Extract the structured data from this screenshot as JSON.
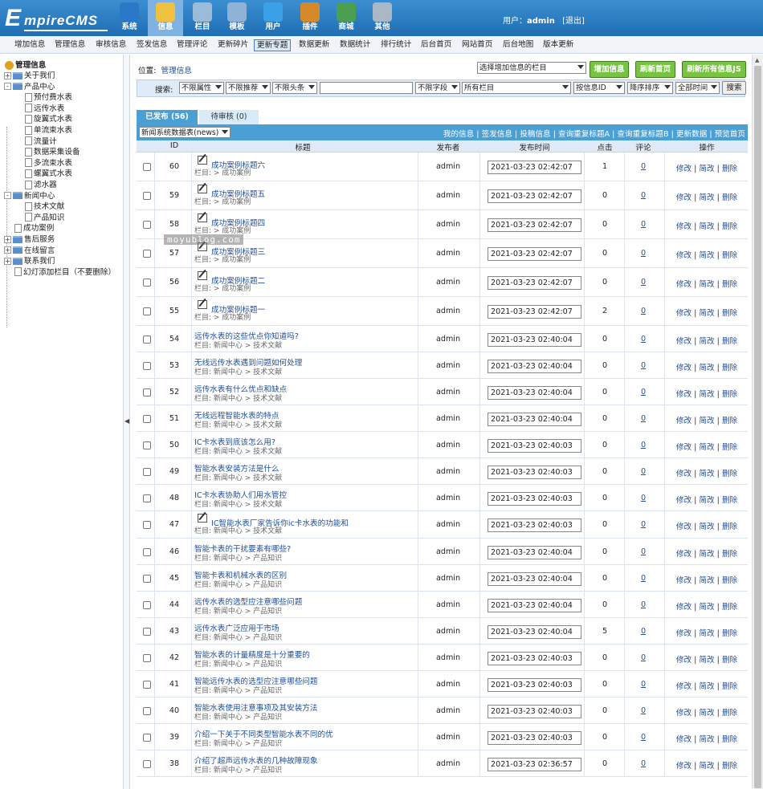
{
  "logo": {
    "big": "E",
    "rest": "mpireCMS"
  },
  "nav": [
    {
      "label": "系统",
      "icon": "globe-icon",
      "color": "#2b78c8",
      "active": false
    },
    {
      "label": "信息",
      "icon": "document-edit-icon",
      "color": "#f0c040",
      "active": true
    },
    {
      "label": "栏目",
      "icon": "folder-icon",
      "color": "#9bbcd8",
      "active": false
    },
    {
      "label": "模板",
      "icon": "template-icon",
      "color": "#8fb3d6",
      "active": false
    },
    {
      "label": "用户",
      "icon": "user-icon",
      "color": "#3aa0e8",
      "active": false
    },
    {
      "label": "插件",
      "icon": "tools-icon",
      "color": "#d58a2a",
      "active": false
    },
    {
      "label": "商城",
      "icon": "shop-icon",
      "color": "#4aa050",
      "active": false
    },
    {
      "label": "其他",
      "icon": "gear-icon",
      "color": "#a9b7c6",
      "active": false
    }
  ],
  "user": {
    "prefix": "用户：",
    "name": "admin",
    "logout": "[退出]"
  },
  "subnav": [
    {
      "label": "增加信息",
      "active": false
    },
    {
      "label": "管理信息",
      "active": false
    },
    {
      "label": "审核信息",
      "active": false
    },
    {
      "label": "签发信息",
      "active": false
    },
    {
      "label": "管理评论",
      "active": false
    },
    {
      "label": "更新碎片",
      "active": false
    },
    {
      "label": "更新专题",
      "active": true
    },
    {
      "label": "数据更新",
      "active": false
    },
    {
      "label": "数据统计",
      "active": false
    },
    {
      "label": "排行统计",
      "active": false
    },
    {
      "label": "后台首页",
      "active": false
    },
    {
      "label": "网站首页",
      "active": false
    },
    {
      "label": "后台地图",
      "active": false
    },
    {
      "label": "版本更新",
      "active": false
    }
  ],
  "tree": {
    "root": "管理信息",
    "nodes": [
      {
        "label": "关于我们",
        "level": 0,
        "type": "folder",
        "box": "+"
      },
      {
        "label": "产品中心",
        "level": 0,
        "type": "folder",
        "box": "-"
      },
      {
        "label": "预付费水表",
        "level": 1,
        "type": "doc"
      },
      {
        "label": "远传水表",
        "level": 1,
        "type": "doc"
      },
      {
        "label": "旋翼式水表",
        "level": 1,
        "type": "doc"
      },
      {
        "label": "单流束水表",
        "level": 1,
        "type": "doc"
      },
      {
        "label": "流量计",
        "level": 1,
        "type": "doc"
      },
      {
        "label": "数据采集设备",
        "level": 1,
        "type": "doc"
      },
      {
        "label": "多流束水表",
        "level": 1,
        "type": "doc"
      },
      {
        "label": "螺翼式水表",
        "level": 1,
        "type": "doc"
      },
      {
        "label": "滤水器",
        "level": 1,
        "type": "doc"
      },
      {
        "label": "新闻中心",
        "level": 0,
        "type": "folder",
        "box": "-"
      },
      {
        "label": "技术文献",
        "level": 1,
        "type": "doc"
      },
      {
        "label": "产品知识",
        "level": 1,
        "type": "doc"
      },
      {
        "label": "成功案例",
        "level": 0,
        "type": "doc"
      },
      {
        "label": "售后服务",
        "level": 0,
        "type": "folder",
        "box": "+"
      },
      {
        "label": "在线留言",
        "level": 0,
        "type": "folder",
        "box": "+"
      },
      {
        "label": "联系我们",
        "level": 0,
        "type": "folder",
        "box": "+"
      },
      {
        "label": "幻灯添加栏目（不要删除）",
        "level": 0,
        "type": "doc"
      }
    ]
  },
  "main": {
    "location_label": "位置:",
    "location_link": "管理信息",
    "column_select": "选择增加信息的栏目",
    "btn_add": "增加信息",
    "btn_refresh_home": "刷新首页",
    "btn_refresh_all": "刷新所有信息JS",
    "search": {
      "label": "搜索:",
      "attr": "不限属性",
      "recommend": "不限推荐",
      "headline": "不限头条",
      "keyword": "",
      "field": "不限字段",
      "column": "所有栏目",
      "order_by": "按信息ID",
      "order": "降序排序",
      "time": "全部时间",
      "button": "搜索"
    },
    "tabs": [
      {
        "label": "已发布 (56)",
        "active": true
      },
      {
        "label": "待审核 (0)",
        "active": false
      }
    ],
    "table_select": "新闻系统数据表(news)",
    "links": "我的信息 | 签发信息 | 投稿信息 | 查询重复标题A | 查询重复标题B | 更新数据 | 预览首页",
    "headers": {
      "id": "ID",
      "title": "标题",
      "publisher": "发布者",
      "time": "发布时间",
      "clicks": "点击",
      "comments": "评论",
      "ops": "操作"
    },
    "op_labels": {
      "edit": "修改",
      "quick": "简改",
      "delete": "删除",
      "sep": " | "
    },
    "rows": [
      {
        "id": "60",
        "title": "成功案例标题六",
        "col": "栏目: > 成功案例",
        "pub": "admin",
        "time": "2021-03-23 02:42:07",
        "clicks": "1",
        "comments": "0",
        "pic": true
      },
      {
        "id": "59",
        "title": "成功案例标题五",
        "col": "栏目: > 成功案例",
        "pub": "admin",
        "time": "2021-03-23 02:42:07",
        "clicks": "0",
        "comments": "0",
        "pic": true
      },
      {
        "id": "58",
        "title": "成功案例标题四",
        "col": "栏目: > 成功案例",
        "pub": "admin",
        "time": "2021-03-23 02:42:07",
        "clicks": "0",
        "comments": "0",
        "pic": true
      },
      {
        "id": "57",
        "title": "成功案例标题三",
        "col": "栏目: > 成功案例",
        "pub": "admin",
        "time": "2021-03-23 02:42:07",
        "clicks": "0",
        "comments": "0",
        "pic": true
      },
      {
        "id": "56",
        "title": "成功案例标题二",
        "col": "栏目: > 成功案例",
        "pub": "admin",
        "time": "2021-03-23 02:42:07",
        "clicks": "0",
        "comments": "0",
        "pic": true
      },
      {
        "id": "55",
        "title": "成功案例标题一",
        "col": "栏目: > 成功案例",
        "pub": "admin",
        "time": "2021-03-23 02:42:07",
        "clicks": "2",
        "comments": "0",
        "pic": true
      },
      {
        "id": "54",
        "title": "远传水表的这些优点你知道吗?",
        "col": "栏目: 新闻中心 > 技术文献",
        "pub": "admin",
        "time": "2021-03-23 02:40:04",
        "clicks": "0",
        "comments": "0",
        "pic": false
      },
      {
        "id": "53",
        "title": "无线远传水表遇到问题如何处理",
        "col": "栏目: 新闻中心 > 技术文献",
        "pub": "admin",
        "time": "2021-03-23 02:40:04",
        "clicks": "0",
        "comments": "0",
        "pic": false
      },
      {
        "id": "52",
        "title": "远传水表有什么优点和缺点",
        "col": "栏目: 新闻中心 > 技术文献",
        "pub": "admin",
        "time": "2021-03-23 02:40:04",
        "clicks": "0",
        "comments": "0",
        "pic": false
      },
      {
        "id": "51",
        "title": "无线远程智能水表的特点",
        "col": "栏目: 新闻中心 > 技术文献",
        "pub": "admin",
        "time": "2021-03-23 02:40:04",
        "clicks": "0",
        "comments": "0",
        "pic": false
      },
      {
        "id": "50",
        "title": "IC卡水表到底该怎么用?",
        "col": "栏目: 新闻中心 > 技术文献",
        "pub": "admin",
        "time": "2021-03-23 02:40:03",
        "clicks": "0",
        "comments": "0",
        "pic": false
      },
      {
        "id": "49",
        "title": "智能水表安装方法是什么",
        "col": "栏目: 新闻中心 > 技术文献",
        "pub": "admin",
        "time": "2021-03-23 02:40:03",
        "clicks": "0",
        "comments": "0",
        "pic": false
      },
      {
        "id": "48",
        "title": "IC卡水表协助人们用水管控",
        "col": "栏目: 新闻中心 > 技术文献",
        "pub": "admin",
        "time": "2021-03-23 02:40:03",
        "clicks": "0",
        "comments": "0",
        "pic": false
      },
      {
        "id": "47",
        "title": "IC智能水表厂家告诉你ic卡水表的功能和",
        "col": "栏目: 新闻中心 > 技术文献",
        "pub": "admin",
        "time": "2021-03-23 02:40:03",
        "clicks": "0",
        "comments": "0",
        "pic": true
      },
      {
        "id": "46",
        "title": "智能卡表的干扰要素有哪些?",
        "col": "栏目: 新闻中心 > 产品知识",
        "pub": "admin",
        "time": "2021-03-23 02:40:04",
        "clicks": "0",
        "comments": "0",
        "pic": false
      },
      {
        "id": "45",
        "title": "智能卡表和机械水表的区别",
        "col": "栏目: 新闻中心 > 产品知识",
        "pub": "admin",
        "time": "2021-03-23 02:40:04",
        "clicks": "0",
        "comments": "0",
        "pic": false
      },
      {
        "id": "44",
        "title": "远传水表的选型应注意哪些问题",
        "col": "栏目: 新闻中心 > 产品知识",
        "pub": "admin",
        "time": "2021-03-23 02:40:04",
        "clicks": "0",
        "comments": "0",
        "pic": false
      },
      {
        "id": "43",
        "title": "远传水表广泛应用于市场",
        "col": "栏目: 新闻中心 > 产品知识",
        "pub": "admin",
        "time": "2021-03-23 02:40:04",
        "clicks": "5",
        "comments": "0",
        "pic": false
      },
      {
        "id": "42",
        "title": "智能水表的计量精度是十分重要的",
        "col": "栏目: 新闻中心 > 产品知识",
        "pub": "admin",
        "time": "2021-03-23 02:40:03",
        "clicks": "0",
        "comments": "0",
        "pic": false
      },
      {
        "id": "41",
        "title": "智能远传水表的选型应注意哪些问题",
        "col": "栏目: 新闻中心 > 产品知识",
        "pub": "admin",
        "time": "2021-03-23 02:40:03",
        "clicks": "0",
        "comments": "0",
        "pic": false
      },
      {
        "id": "40",
        "title": "智能水表使用注意事项及其安装方法",
        "col": "栏目: 新闻中心 > 产品知识",
        "pub": "admin",
        "time": "2021-03-23 02:40:03",
        "clicks": "0",
        "comments": "0",
        "pic": false
      },
      {
        "id": "39",
        "title": "介绍一下关于不同类型智能水表不同的优",
        "col": "栏目: 新闻中心 > 产品知识",
        "pub": "admin",
        "time": "2021-03-23 02:40:03",
        "clicks": "0",
        "comments": "0",
        "pic": false
      },
      {
        "id": "38",
        "title": "介绍了超声远传水表的几种故障现象",
        "col": "栏目: 新闻中心 > 产品知识",
        "pub": "admin",
        "time": "2021-03-23 02:36:57",
        "clicks": "0",
        "comments": "0",
        "pic": false
      }
    ]
  },
  "watermark": "moyublog.com"
}
